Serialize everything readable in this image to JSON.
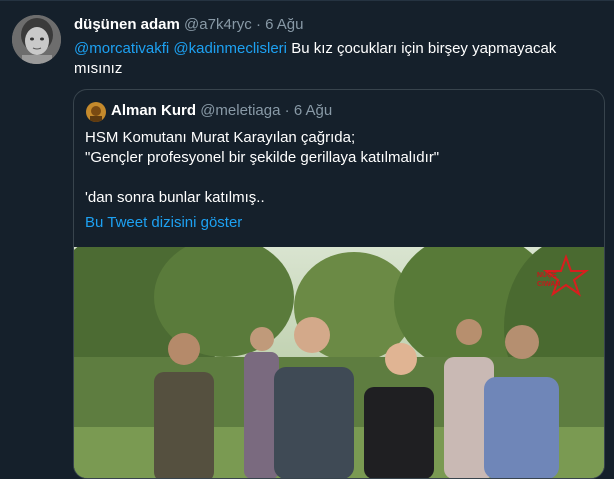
{
  "tweet": {
    "display_name": "düşünen adam",
    "handle": "@a7k4ryc",
    "separator": "·",
    "date": "6 Ağu",
    "mentions": [
      "@morcativakfi",
      "@kadinmeclisleri"
    ],
    "text": "Bu kız çocukları için birşey yapmayacak mısınız"
  },
  "quoted_tweet": {
    "display_name": "Alman Kurd",
    "handle": "@meletiaga",
    "separator": "·",
    "date": "6 Ağu",
    "text": "HSM Komutanı Murat Karayılan çağrıda;\n\"Gençler profesyonel bir şekilde gerillaya katılmalıdır\"\n\n'dan sonra bunlar katılmış..",
    "thread_link": "Bu Tweet dizisini göster",
    "media_watermark_line1": "NÛÇE",
    "media_watermark_line2": "CIWAN"
  },
  "colors": {
    "background": "#15202b",
    "accent": "#1da1f2",
    "muted": "#8899a6",
    "border": "#38444d"
  }
}
